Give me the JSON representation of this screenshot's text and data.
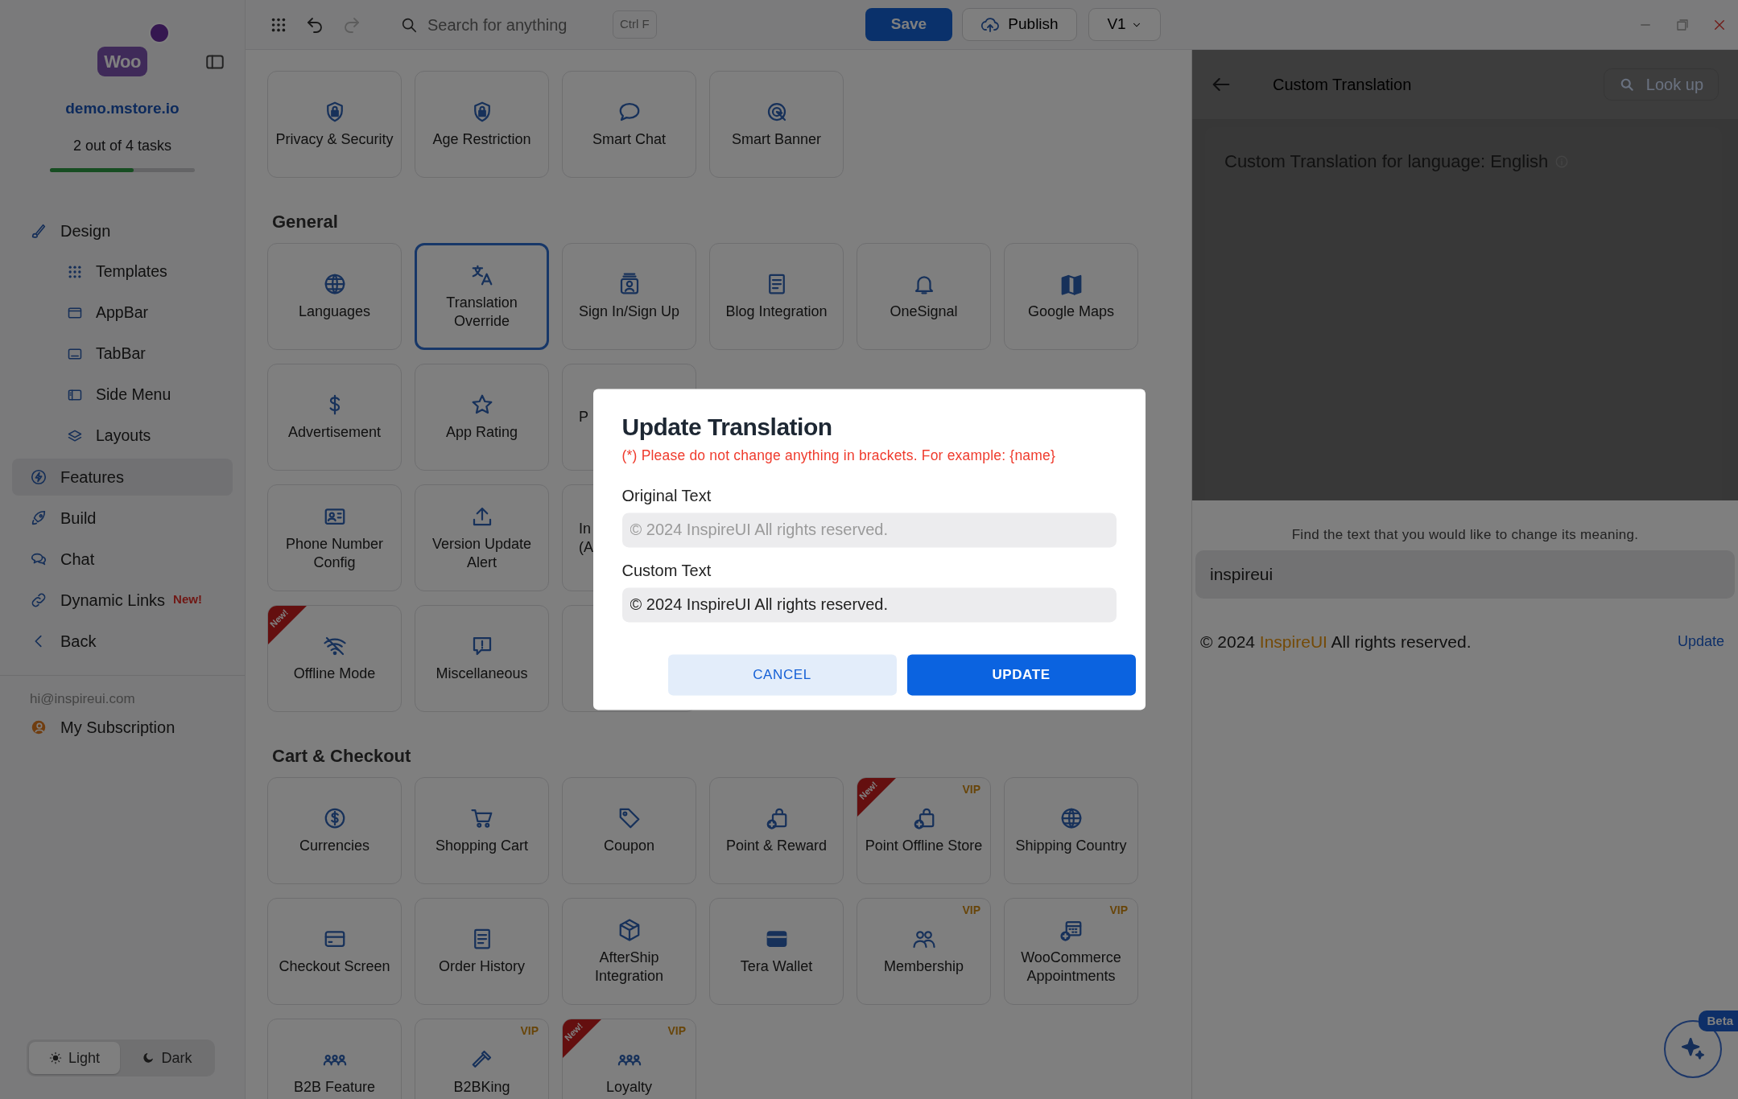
{
  "sidebar": {
    "logo": "Woo",
    "site": "demo.mstore.io",
    "tasks": "2 out of 4 tasks",
    "task_progress": {
      "level": 0.58
    },
    "nav": [
      {
        "label": "Design",
        "selected": false,
        "children": [
          {
            "label": "Templates",
            "selected": false
          },
          {
            "label": "AppBar",
            "selected": false
          },
          {
            "label": "TabBar",
            "selected": false
          },
          {
            "label": "Side Menu",
            "selected": false
          },
          {
            "label": "Layouts",
            "selected": false
          }
        ]
      },
      {
        "label": "Features",
        "selected": true
      },
      {
        "label": "Build",
        "selected": false
      },
      {
        "label": "Chat",
        "selected": false
      },
      {
        "label": "Dynamic Links",
        "selected": false,
        "badge": "New!"
      },
      {
        "label": "Back",
        "selected": false
      }
    ],
    "account": {
      "email": "hi@inspireui.com",
      "subscription": "My Subscription"
    },
    "theme": [
      {
        "label": "Light",
        "selected": true
      },
      {
        "label": "Dark",
        "selected": false
      }
    ]
  },
  "toolbar": {
    "undo": {
      "disabled": false
    },
    "redo": {
      "disabled": true
    },
    "search": {
      "placeholder": "Search for anything",
      "shortcut": "Ctrl F"
    },
    "save": "Save",
    "publish": "Publish",
    "version": "V1"
  },
  "sections": [
    {
      "rows": [
        {
          "cards": [
            {
              "label": "Privacy & Security",
              "selected": false
            },
            {
              "label": "Age Restriction",
              "selected": false
            },
            {
              "label": "Smart Chat",
              "selected": false
            },
            {
              "label": "Smart Banner",
              "selected": false
            }
          ]
        }
      ]
    },
    {
      "title": "General",
      "rows": [
        {
          "cards": [
            {
              "label": "Languages",
              "selected": false
            },
            {
              "label": "Translation Override",
              "selected": true
            },
            {
              "label": "Sign In/Sign Up",
              "selected": false
            },
            {
              "label": "Blog Integration",
              "selected": false
            },
            {
              "label": "OneSignal",
              "selected": false
            },
            {
              "label": "Google Maps",
              "selected": false
            }
          ]
        },
        {
          "cards": [
            {
              "label": "Advertisement",
              "selected": false
            },
            {
              "label": "App Rating",
              "selected": false
            },
            {
              "label": "P",
              "selected": false,
              "clipped": true
            }
          ]
        },
        {
          "cards": [
            {
              "label": "Phone Number Config",
              "selected": false
            },
            {
              "label": "Version Update Alert",
              "selected": false
            },
            {
              "label": "In (A",
              "selected": false,
              "clipped": true
            }
          ]
        },
        {
          "cards": [
            {
              "label": "Offline Mode",
              "selected": false,
              "ribbon": "New!"
            },
            {
              "label": "Miscellaneous",
              "selected": false
            },
            {
              "selected": false
            }
          ]
        }
      ]
    },
    {
      "title": "Cart & Checkout",
      "rows": [
        {
          "cards": [
            {
              "label": "Currencies",
              "selected": false
            },
            {
              "label": "Shopping Cart",
              "selected": false
            },
            {
              "label": "Coupon",
              "selected": false
            },
            {
              "label": "Point & Reward",
              "selected": false
            },
            {
              "label": "Point Offline Store",
              "selected": false,
              "ribbon": "New!",
              "tag": "VIP"
            },
            {
              "label": "Shipping Country",
              "selected": false
            }
          ]
        },
        {
          "cards": [
            {
              "label": "Checkout Screen",
              "selected": false
            },
            {
              "label": "Order History",
              "selected": false
            },
            {
              "label": "AfterShip Integration",
              "selected": false
            },
            {
              "label": "Tera Wallet",
              "selected": false
            },
            {
              "label": "Membership",
              "selected": false,
              "tag": "VIP"
            },
            {
              "label": "WooCommerce Appointments",
              "selected": false,
              "tag": "VIP"
            }
          ]
        },
        {
          "cards": [
            {
              "label": "B2B Feature",
              "selected": false
            },
            {
              "label": "B2BKing",
              "selected": false,
              "tag": "VIP"
            },
            {
              "label": "Loyalty",
              "selected": false,
              "ribbon": "New!",
              "tag": "VIP"
            }
          ]
        }
      ]
    }
  ],
  "panel": {
    "title": "Custom Translation",
    "lookup": "Look up",
    "preview_heading": "Custom Translation for language: English",
    "hint": "Find the text that you would like to change its meaning.",
    "search": {
      "value": "inspireui"
    },
    "results": [
      {
        "before": "© 2024 ",
        "match": "InspireUI",
        "after": " All rights reserved.",
        "action": "Update"
      }
    ],
    "assistant": {
      "badge": "Beta"
    }
  },
  "dialog": {
    "title": "Update Translation",
    "warning": "(*) Please do not change anything in brackets. For example: {name}",
    "fields": [
      {
        "label": "Original Text",
        "value": "© 2024 InspireUI All rights reserved.",
        "disabled": true
      },
      {
        "label": "Custom Text",
        "value": "© 2024 InspireUI All rights reserved.",
        "disabled": false
      }
    ],
    "buttons": [
      {
        "label": "CANCEL",
        "kind": "secondary"
      },
      {
        "label": "UPDATE",
        "kind": "primary"
      }
    ]
  }
}
